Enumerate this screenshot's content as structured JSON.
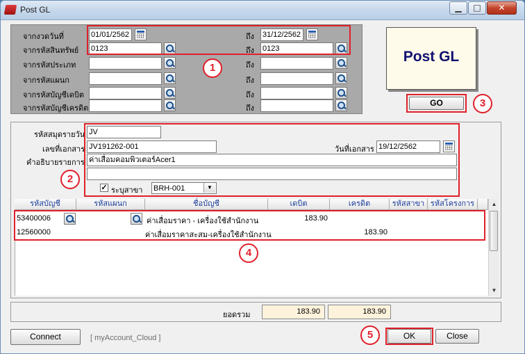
{
  "window": {
    "title": "Post GL",
    "min": "▁",
    "max": "□",
    "close": "✕"
  },
  "filters": {
    "date_from_label": "จากงวดวันที่",
    "date_from": "01/01/2562",
    "date_to_label": "ถึง",
    "date_to": "31/12/2562",
    "asset_from_label": "จากรหัสสินทรัพย์",
    "asset_from": "0123",
    "asset_to_label": "ถึง",
    "asset_to": "0123",
    "type_from_label": "จากรหัสประเภท",
    "type_to_label": "ถึง",
    "dept_from_label": "จากรหัสแผนก",
    "dept_to_label": "ถึง",
    "debit_from_label": "จากรหัสบัญชีเดบิต",
    "debit_to_label": "ถึง",
    "credit_from_label": "จากรหัสบัญชีเครดิต",
    "credit_to_label": "ถึง"
  },
  "logo": {
    "text": "Post GL"
  },
  "go_button": "GO",
  "document": {
    "journal_label": "รหัสสมุดรายวัน",
    "journal": "JV",
    "docno_label": "เลขที่เอกสาร",
    "docno": "JV191262-001",
    "docdate_label": "วันที่เอกสาร",
    "docdate": "19/12/2562",
    "desc_label": "คำอธิบายรายการ",
    "desc": "ค่าเสื่อมคอมพิวเตอร์Acer1",
    "desc2": "",
    "branch_check": "✓",
    "branch_label": "ระบุสาขา",
    "branch": "BRH-001"
  },
  "grid": {
    "columns": [
      "รหัสบัญชี",
      "รหัสแผนก",
      "ชื่อบัญชี",
      "เดบิต",
      "เครดิต",
      "รหัสสาขา",
      "รหัสโครงการ"
    ],
    "rows": [
      {
        "account": "53400006",
        "dept": "",
        "name": "ค่าเสื่อมราคา - เครื่องใช้สำนักงาน",
        "debit": "183.90",
        "credit": "",
        "branch": "",
        "project": ""
      },
      {
        "account": "12560000",
        "dept": "",
        "name": "ค่าเสื่อมราคาสะสม-เครื่องใช้สำนักงาน",
        "debit": "",
        "credit": "183.90",
        "branch": "",
        "project": ""
      }
    ]
  },
  "totals": {
    "label": "ยอดรวม",
    "debit": "183.90",
    "credit": "183.90"
  },
  "footer": {
    "connect": "Connect",
    "account": "[ myAccount_Cloud ]",
    "ok": "OK",
    "close": "Close"
  },
  "badges": [
    "1",
    "2",
    "3",
    "4",
    "5"
  ],
  "colors": {
    "highlight": "#e0202a",
    "logo_text": "#101070",
    "header_text": "#1d3f9a"
  }
}
